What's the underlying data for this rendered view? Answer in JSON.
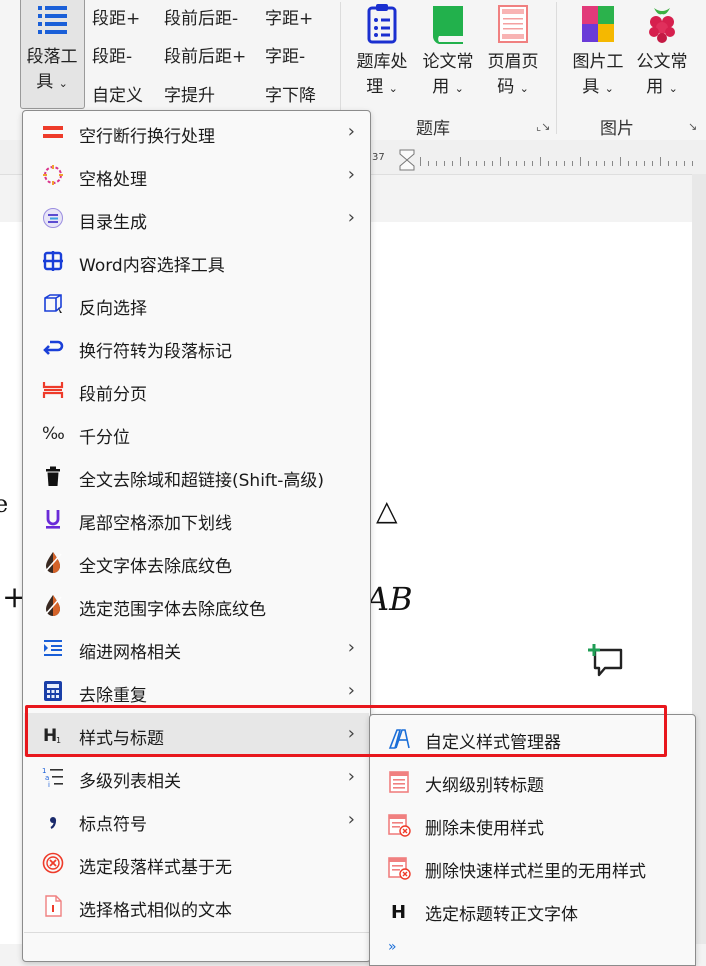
{
  "ribbon": {
    "paragraph_tool": "段落工具",
    "paragraph_tool_line1": "段落工",
    "paragraph_tool_line2": "具",
    "small_buttons": [
      [
        "段距+",
        "段前后距-",
        "字距+"
      ],
      [
        "段距-",
        "段前后距+",
        "字距-"
      ],
      [
        "自定义",
        "字提升",
        "字下降"
      ]
    ],
    "question_bank_line1": "题库处",
    "question_bank_line2": "理",
    "paper_common_line1": "论文常",
    "paper_common_line2": "用",
    "header_footer_line1": "页眉页",
    "header_footer_line2": "码",
    "image_tool_line1": "图片工",
    "image_tool_line2": "具",
    "official_doc_line1": "公文常",
    "official_doc_line2": "用",
    "group_question_bank": "题库",
    "group_image": "图片"
  },
  "ruler": {
    "number": "37"
  },
  "document": {
    "fragment_left_top": "e",
    "fragment_triangle": "△",
    "fragment_plus": "+",
    "fragment_ab": "AB"
  },
  "menu": {
    "items": [
      {
        "label": "空行断行换行处理",
        "icon": "double-bar-icon",
        "submenu": true
      },
      {
        "label": "空格处理",
        "icon": "spark-circle-icon",
        "submenu": true
      },
      {
        "label": "目录生成",
        "icon": "toc-icon",
        "submenu": true
      },
      {
        "label": "Word内容选择工具",
        "icon": "grid-select-icon",
        "submenu": false
      },
      {
        "label": "反向选择",
        "icon": "reverse-select-icon",
        "submenu": false
      },
      {
        "label": "换行符转为段落标记",
        "icon": "return-arrow-icon",
        "submenu": false
      },
      {
        "label": "段前分页",
        "icon": "page-break-icon",
        "submenu": false
      },
      {
        "label": "千分位",
        "icon": "permille-icon",
        "submenu": false
      },
      {
        "label": "全文去除域和超链接(Shift-高级)",
        "icon": "trash-icon",
        "submenu": false
      },
      {
        "label": "尾部空格添加下划线",
        "icon": "underline-icon",
        "submenu": false
      },
      {
        "label": "全文字体去除底纹色",
        "icon": "shading-drop-icon",
        "submenu": false
      },
      {
        "label": "选定范围字体去除底纹色",
        "icon": "shading-drop-icon",
        "submenu": false
      },
      {
        "label": "缩进网格相关",
        "icon": "indent-icon",
        "submenu": true
      },
      {
        "label": "去除重复",
        "icon": "dedupe-icon",
        "submenu": true
      },
      {
        "label": "样式与标题",
        "icon": "heading-icon",
        "submenu": true
      },
      {
        "label": "多级列表相关",
        "icon": "multilevel-list-icon",
        "submenu": true
      },
      {
        "label": "标点符号",
        "icon": "comma-icon",
        "submenu": true
      },
      {
        "label": "选定段落样式基于无",
        "icon": "circle-x-icon",
        "submenu": false
      },
      {
        "label": "选择格式相似的文本",
        "icon": "doc-select-icon",
        "submenu": false
      }
    ]
  },
  "submenu": {
    "items": [
      {
        "label": "自定义样式管理器",
        "icon": "style-manager-icon"
      },
      {
        "label": "大纲级别转标题",
        "icon": "outline-doc-icon"
      },
      {
        "label": "删除未使用样式",
        "icon": "delete-doc-icon"
      },
      {
        "label": "删除快速样式栏里的无用样式",
        "icon": "delete-doc-icon"
      },
      {
        "label": "选定标题转正文字体",
        "icon": "bold-h-icon"
      }
    ]
  },
  "colors": {
    "highlight_box": "#e8171d",
    "accent_blue": "#1a3fd8",
    "accent_red": "#ee3b2a",
    "accent_green": "#22b14c"
  }
}
